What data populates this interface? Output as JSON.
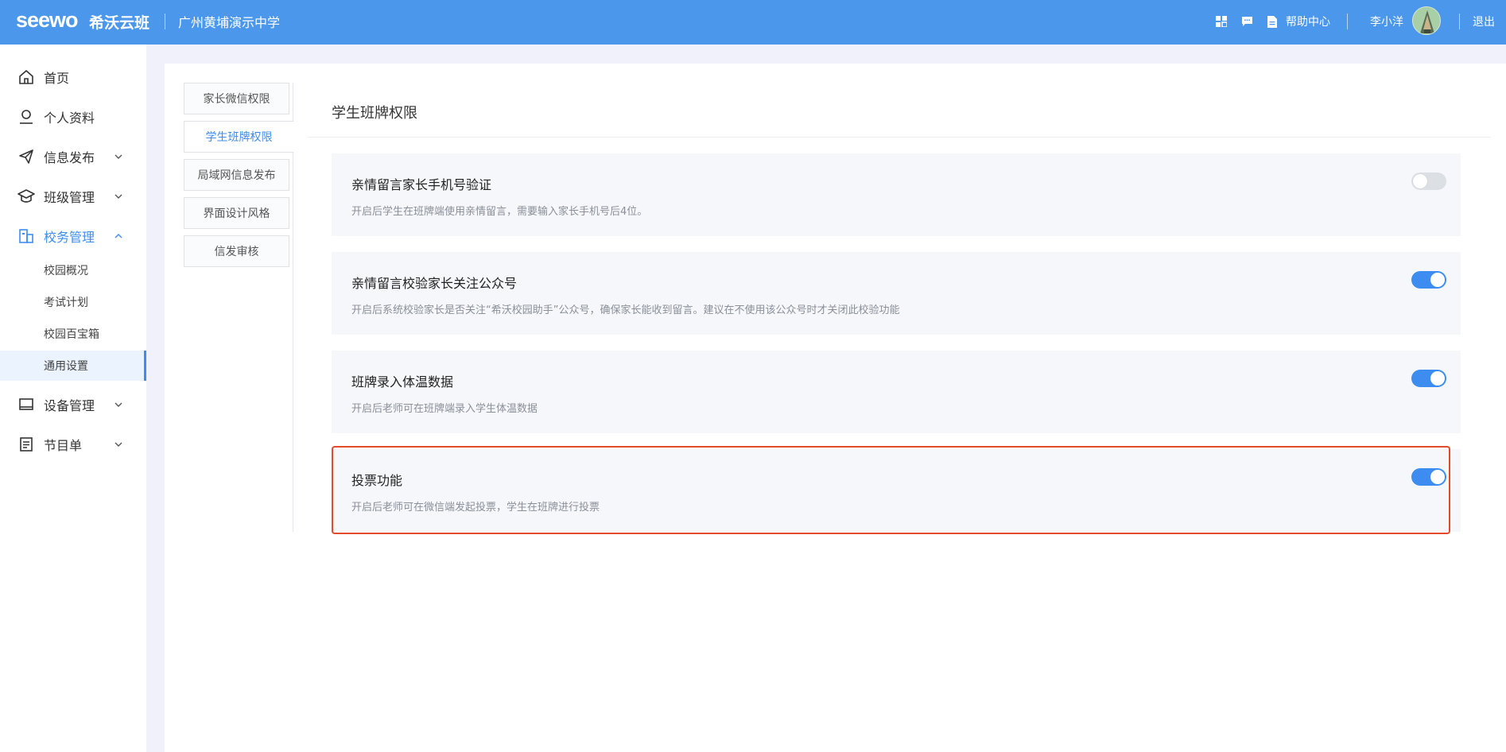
{
  "header": {
    "logo": "seewo",
    "app_name": "希沃云班",
    "school": "广州黄埔演示中学",
    "help_label": "帮助中心",
    "user_name": "李小洋",
    "logout_label": "退出",
    "icons": [
      "apps-grid-icon",
      "message-icon",
      "document-icon"
    ],
    "brand_color": "#4b97ec"
  },
  "sidebar": {
    "items": [
      {
        "label": "首页",
        "icon": "home-icon"
      },
      {
        "label": "个人资料",
        "icon": "user-icon"
      },
      {
        "label": "信息发布",
        "icon": "send-icon",
        "expandable": true
      },
      {
        "label": "班级管理",
        "icon": "graduation-cap-icon",
        "expandable": true
      },
      {
        "label": "校务管理",
        "icon": "building-icon",
        "expandable": true,
        "expanded": true,
        "active": true
      },
      {
        "label": "设备管理",
        "icon": "monitor-icon",
        "expandable": true
      },
      {
        "label": "节目单",
        "icon": "list-icon",
        "expandable": true
      }
    ],
    "subitems": [
      {
        "label": "校园概况"
      },
      {
        "label": "考试计划"
      },
      {
        "label": "校园百宝箱"
      },
      {
        "label": "通用设置",
        "active": true
      }
    ],
    "accent": "#3d8df0"
  },
  "tabs": [
    {
      "label": "家长微信权限"
    },
    {
      "label": "学生班牌权限",
      "active": true
    },
    {
      "label": "局域网信息发布"
    },
    {
      "label": "界面设计风格"
    },
    {
      "label": "信发审核"
    }
  ],
  "main": {
    "title": "学生班牌权限",
    "settings": [
      {
        "title": "亲情留言家长手机号验证",
        "desc": "开启后学生在班牌端使用亲情留言，需要输入家长手机号后4位。",
        "enabled": false
      },
      {
        "title": "亲情留言校验家长关注公众号",
        "desc": "开启后系统校验家长是否关注“希沃校园助手”公众号，确保家长能收到留言。建议在不使用该公众号时才关闭此校验功能",
        "enabled": true
      },
      {
        "title": "班牌录入体温数据",
        "desc": "开启后老师可在班牌端录入学生体温数据",
        "enabled": true
      },
      {
        "title": "投票功能",
        "desc": "开启后老师可在微信端发起投票，学生在班牌进行投票",
        "enabled": true,
        "highlighted": true
      }
    ],
    "highlight_color": "#e34b2c"
  }
}
